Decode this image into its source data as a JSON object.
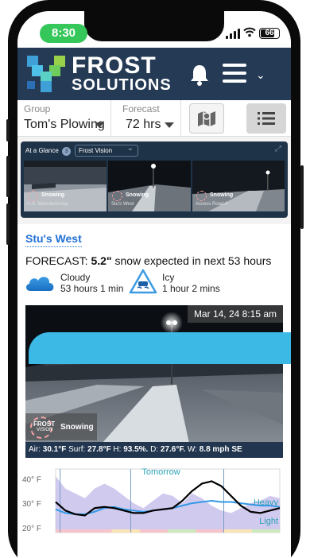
{
  "status_bar": {
    "time": "8:30",
    "battery": "66"
  },
  "brand": {
    "line1": "FROST",
    "line2": "SOLUTIONS"
  },
  "filters": {
    "group_label": "Group",
    "group_value": "Tom's Plowing",
    "forecast_label": "Forecast",
    "forecast_value": "72 hrs"
  },
  "glance": {
    "title": "At a Glance",
    "count": "3",
    "view": "Frost Vision",
    "cameras": [
      {
        "status": "Snowing",
        "name": "U.S. Manufacturing"
      },
      {
        "status": "Snowing",
        "name": "Stu's West"
      },
      {
        "status": "Snowing",
        "name": "Access Road A"
      }
    ]
  },
  "site": {
    "name": "Stu's West",
    "forecast_prefix": "FORECAST:",
    "forecast_amount": "5.2\"",
    "forecast_rest": "snow expected in next 53 hours",
    "conditions": [
      {
        "icon": "cloud-icon",
        "label": "Cloudy",
        "duration": "53 hours 1 min"
      },
      {
        "icon": "icy-road-icon",
        "label": "Icy",
        "duration": "1 hour 2 mins"
      }
    ]
  },
  "camera": {
    "timestamp": "Mar 14, 24 8:15 am",
    "badge_line1": "FROST",
    "badge_line2": "VISION",
    "status": "Snowing",
    "readings": {
      "air_label": "Air:",
      "air": "30.1°F",
      "surf_label": "Surf:",
      "surf": "27.8°F",
      "h_label": "H:",
      "h": "93.5%.",
      "d_label": "D:",
      "d": "27.6°F.",
      "w_label": "W:",
      "w": "8.8 mph SE"
    }
  },
  "chart_data": {
    "type": "line",
    "y_ticks": [
      "40° F",
      "30° F",
      "20° F"
    ],
    "ylim": [
      18,
      44
    ],
    "annotation_top": "Tomorrow",
    "annotation_right_1": "Heavy",
    "annotation_right_2": "Light",
    "series": [
      {
        "values": [
          30.5,
          27,
          25.5,
          25,
          28,
          28.5,
          28,
          27,
          26,
          26,
          27,
          27.5,
          28,
          31,
          35,
          38,
          39,
          37,
          33,
          29,
          26.5,
          26,
          27,
          28
        ]
      },
      {
        "values": [
          27.5,
          26,
          25.5,
          25.5,
          26.5,
          28,
          28.5,
          27.5,
          27,
          26.5,
          27,
          27.5,
          28,
          29,
          30,
          30.5,
          31,
          30.5,
          30.5,
          30,
          29.5,
          29,
          29,
          28.5
        ]
      },
      {
        "values": [
          41,
          36,
          34,
          32,
          36,
          38,
          36,
          33,
          30,
          28,
          31,
          34,
          33,
          30,
          34,
          32,
          29,
          27,
          26,
          28,
          30,
          31,
          33,
          32
        ]
      }
    ],
    "colors": {
      "air": "#000000",
      "surface": "#3399e6",
      "area": "#c9c1ec"
    }
  }
}
